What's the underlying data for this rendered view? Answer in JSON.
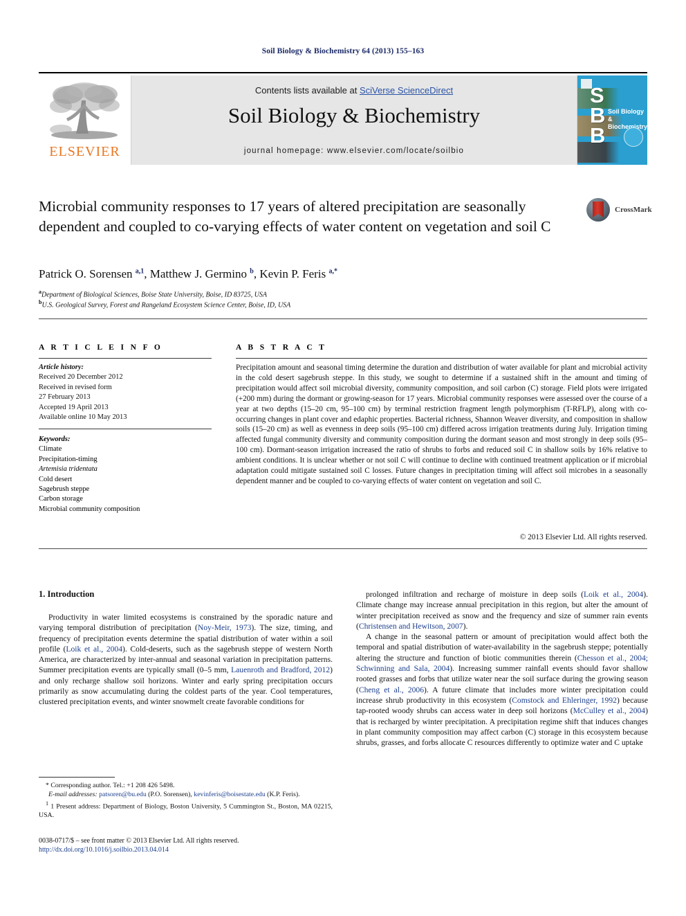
{
  "running_head": "Soil Biology & Biochemistry 64 (2013) 155–163",
  "masthead": {
    "publisher_logo_label": "ELSEVIER",
    "contents_prefix": "Contents lists available at ",
    "contents_link": "SciVerse ScienceDirect",
    "journal_title": "Soil Biology & Biochemistry",
    "homepage": "journal homepage: www.elsevier.com/locate/soilbio",
    "cover": {
      "initials": "S\nB\nB",
      "cover_title": "Soil Biology & Biochemistry"
    }
  },
  "article": {
    "title": "Microbial community responses to 17 years of altered precipitation are seasonally dependent and coupled to co-varying effects of water content on vegetation and soil C",
    "crossmark_label": "CrossMark",
    "authors_html": "Patrick O. Sorensen <sup>a,1</sup>, Matthew J. Germino <sup>b</sup>, Kevin P. Feris <sup>a,*</sup>",
    "affiliation_a": "Department of Biological Sciences, Boise State University, Boise, ID 83725, USA",
    "affiliation_b": "U.S. Geological Survey, Forest and Rangeland Ecosystem Science Center, Boise, ID, USA"
  },
  "article_info": {
    "heading": "A R T I C L E   I N F O",
    "history_label": "Article history:",
    "history_lines": [
      "Received 20 December 2012",
      "Received in revised form",
      "27 February 2013",
      "Accepted 19 April 2013",
      "Available online 10 May 2013"
    ],
    "keywords_label": "Keywords:",
    "keywords": [
      "Climate",
      "Precipitation-timing",
      "Artemisia tridentata",
      "Cold desert",
      "Sagebrush steppe",
      "Carbon storage",
      "Microbial community composition"
    ]
  },
  "abstract": {
    "heading": "A B S T R A C T",
    "text": "Precipitation amount and seasonal timing determine the duration and distribution of water available for plant and microbial activity in the cold desert sagebrush steppe. In this study, we sought to determine if a sustained shift in the amount and timing of precipitation would affect soil microbial diversity, community composition, and soil carbon (C) storage. Field plots were irrigated (+200 mm) during the dormant or growing-season for 17 years. Microbial community responses were assessed over the course of a year at two depths (15–20 cm, 95–100 cm) by terminal restriction fragment length polymorphism (T-RFLP), along with co-occurring changes in plant cover and edaphic properties. Bacterial richness, Shannon Weaver diversity, and composition in shallow soils (15–20 cm) as well as evenness in deep soils (95–100 cm) differed across irrigation treatments during July. Irrigation timing affected fungal community diversity and community composition during the dormant season and most strongly in deep soils (95–100 cm). Dormant-season irrigation increased the ratio of shrubs to forbs and reduced soil C in shallow soils by 16% relative to ambient conditions. It is unclear whether or not soil C will continue to decline with continued treatment application or if microbial adaptation could mitigate sustained soil C losses. Future changes in precipitation timing will affect soil microbes in a seasonally dependent manner and be coupled to co-varying effects of water content on vegetation and soil C.",
    "copyright": "© 2013 Elsevier Ltd. All rights reserved."
  },
  "body": {
    "section_heading": "1. Introduction",
    "left_paragraphs": [
      "Productivity in water limited ecosystems is constrained by the sporadic nature and varying temporal distribution of precipitation (<span class=\"ref\">Noy-Meir, 1973</span>). The size, timing, and frequency of precipitation events determine the spatial distribution of water within a soil profile (<span class=\"ref\">Loik et al., 2004</span>). Cold-deserts, such as the sagebrush steppe of western North America, are characterized by inter-annual and seasonal variation in precipitation patterns. Summer precipitation events are typically small (0–5 mm, <span class=\"ref\">Lauenroth and Bradford, 2012</span>) and only recharge shallow soil horizons. Winter and early spring precipitation occurs primarily as snow accumulating during the coldest parts of the year. Cool temperatures, clustered precipitation events, and winter snowmelt create favorable conditions for"
    ],
    "right_paragraphs": [
      "prolonged infiltration and recharge of moisture in deep soils (<span class=\"ref\">Loik et al., 2004</span>). Climate change may increase annual precipitation in this region, but alter the amount of winter precipitation received as snow and the frequency and size of summer rain events (<span class=\"ref\">Christensen and Hewitson, 2007</span>).",
      "A change in the seasonal pattern or amount of precipitation would affect both the temporal and spatial distribution of water-availability in the sagebrush steppe; potentially altering the structure and function of biotic communities therein (<span class=\"ref\">Chesson et al., 2004; Schwinning and Sala, 2004</span>). Increasing summer rainfall events should favor shallow rooted grasses and forbs that utilize water near the soil surface during the growing season (<span class=\"ref\">Cheng et al., 2006</span>). A future climate that includes more winter precipitation could increase shrub productivity in this ecosystem (<span class=\"ref\">Comstock and Ehleringer, 1992</span>) because tap-rooted woody shrubs can access water in deep soil horizons (<span class=\"ref\">McCulley et al., 2004</span>) that is recharged by winter precipitation. A precipitation regime shift that induces changes in plant community composition may affect carbon (C) storage in this ecosystem because shrubs, grasses, and forbs allocate C resources differently to optimize water and C uptake"
    ]
  },
  "footnotes": {
    "corresponding": "* Corresponding author. Tel.: +1 208 426 5498.",
    "email_html": "<span class=\"ital\">E-mail addresses:</span> <span class=\"mail\">patsoren@bu.edu</span> (P.O. Sorensen), <span class=\"mail\">kevinferis@boisestate.edu</span> (K.P. Feris).",
    "present_address": "1 Present address: Department of Biology, Boston University, 5 Cummington St., Boston, MA 02215, USA."
  },
  "imprint": {
    "issn_line": "0038-0717/$ – see front matter © 2013 Elsevier Ltd. All rights reserved.",
    "doi": "http://dx.doi.org/10.1016/j.soilbio.2013.04.014"
  },
  "colors": {
    "link_blue": "#2953a5",
    "ref_blue": "#1b3e8c",
    "elsevier_orange": "#e87722",
    "cover_cyan": "#2a9fd0",
    "masthead_grey": "#e6e6e6"
  }
}
